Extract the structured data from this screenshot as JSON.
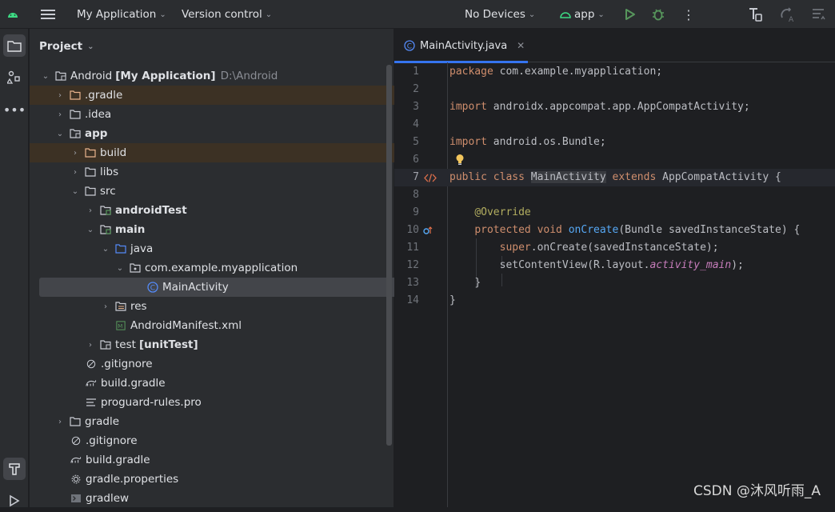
{
  "titlebar": {
    "project_menu": "My Application",
    "vcs_menu": "Version control",
    "device_menu": "No Devices",
    "run_config": "app"
  },
  "project_panel": {
    "title": "Project",
    "tree": [
      {
        "label": "Android",
        "bold_suffix": "[My Application]",
        "hint": "D:\\Android"
      },
      {
        "label": ".gradle"
      },
      {
        "label": ".idea"
      },
      {
        "label": "app"
      },
      {
        "label": "build"
      },
      {
        "label": "libs"
      },
      {
        "label": "src"
      },
      {
        "label": "androidTest"
      },
      {
        "label": "main"
      },
      {
        "label": "java"
      },
      {
        "label": "com.example.myapplication"
      },
      {
        "label": "MainActivity"
      },
      {
        "label": "res"
      },
      {
        "label": "AndroidManifest.xml"
      },
      {
        "label": "test",
        "bold_suffix": "[unitTest]"
      },
      {
        "label": ".gitignore"
      },
      {
        "label": "build.gradle"
      },
      {
        "label": "proguard-rules.pro"
      },
      {
        "label": "gradle"
      },
      {
        "label": ".gitignore"
      },
      {
        "label": "build.gradle"
      },
      {
        "label": "gradle.properties"
      },
      {
        "label": "gradlew"
      }
    ]
  },
  "editor": {
    "tab_label": "MainActivity.java",
    "line_numbers": [
      "1",
      "2",
      "3",
      "4",
      "5",
      "6",
      "7",
      "8",
      "9",
      "10",
      "11",
      "12",
      "13",
      "14"
    ],
    "lines": {
      "l1_kw": "package",
      "l1_rest": " com.example.myapplication;",
      "l3_kw": "import",
      "l3_rest": " androidx.appcompat.app.AppCompatActivity;",
      "l5_kw": "import",
      "l5_rest": " android.os.Bundle;",
      "l7_kw1": "public class",
      "l7_name": "MainActivity",
      "l7_kw2": "extends",
      "l7_rest": " AppCompatActivity {",
      "l9_ann": "@Override",
      "l10_kw": "protected void",
      "l10_fn": "onCreate",
      "l10_rest": "(Bundle savedInstanceState) {",
      "l11_kw": "super",
      "l11_rest": ".onCreate(savedInstanceState);",
      "l12_a": "setContentView(R.layout.",
      "l12_it": "activity_main",
      "l12_b": ");",
      "l13": "}",
      "l14": "}"
    }
  },
  "watermark": "CSDN @沐风听雨_A"
}
